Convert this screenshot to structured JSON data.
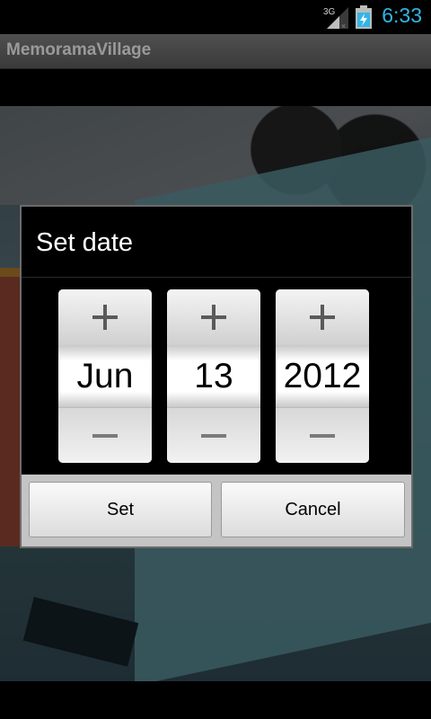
{
  "status_bar": {
    "network_label": "3G",
    "time": "6:33",
    "time_color": "#33b5e5",
    "icons": [
      "signal-icon",
      "battery-charging-icon"
    ]
  },
  "app": {
    "title": "MemoramaVillage"
  },
  "dialog": {
    "title": "Set date",
    "month": "Jun",
    "day": "13",
    "year": "2012",
    "buttons": {
      "set": "Set",
      "cancel": "Cancel"
    }
  },
  "colors": {
    "accent": "#33b5e5",
    "dialog_background": "#000000",
    "button_bar": "#c4c4c4"
  }
}
